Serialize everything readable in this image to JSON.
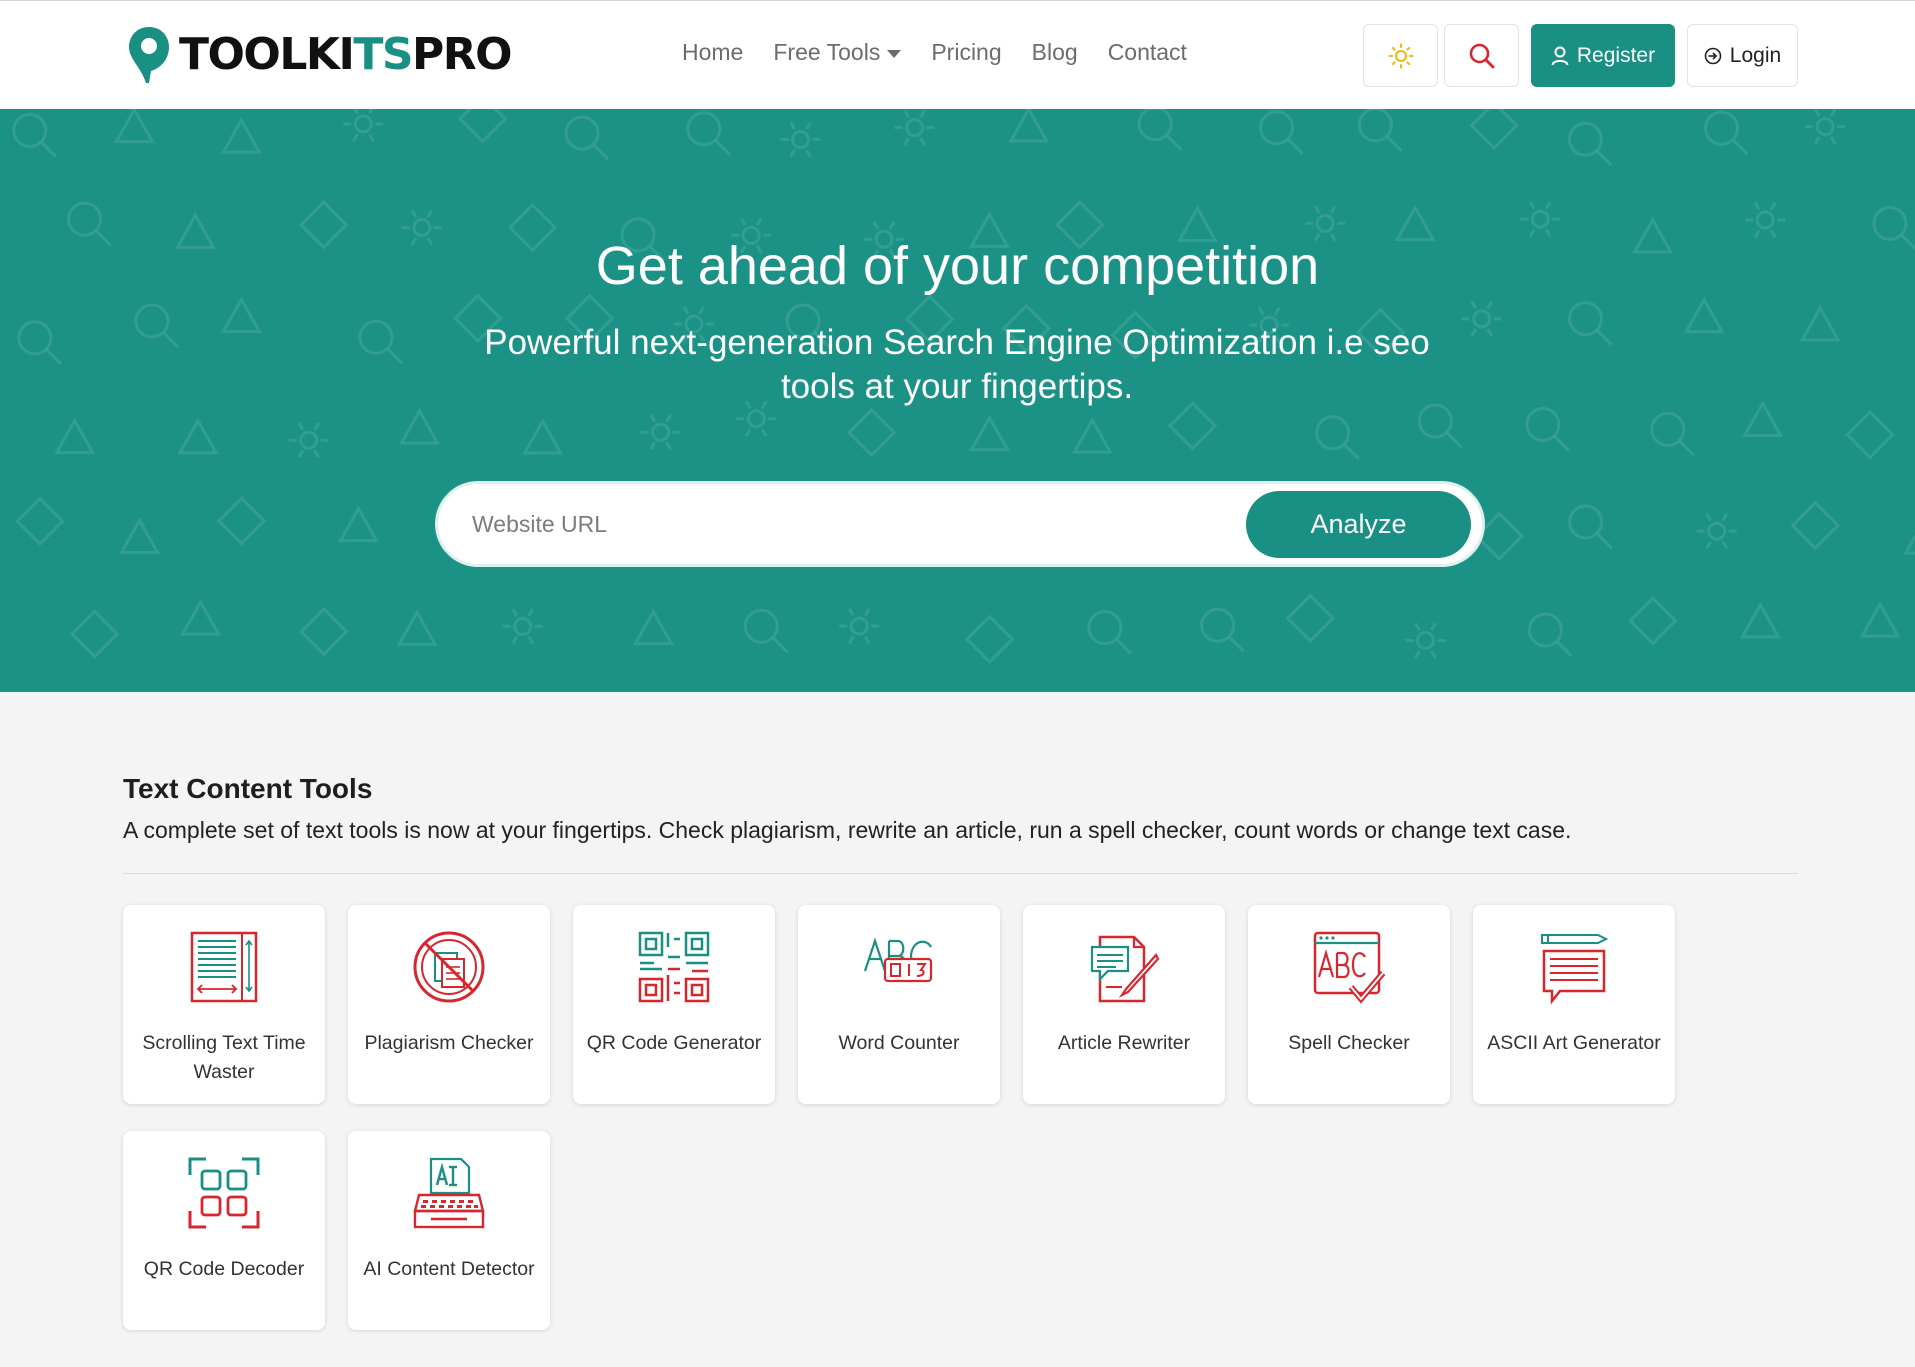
{
  "brand": {
    "part1": "TOOLKI",
    "part2": "TS",
    "part3": "PRO",
    "pin_color": "#1a8f83"
  },
  "nav": {
    "links": [
      "Home",
      "Free Tools",
      "Pricing",
      "Blog",
      "Contact"
    ],
    "theme_icon": "sun-icon",
    "search_icon": "search-icon",
    "register_label": "Register",
    "login_label": "Login"
  },
  "hero": {
    "title": "Get ahead of your competition",
    "subtitle": "Powerful next-generation Search Engine Optimization i.e seo tools at your fingertips.",
    "input_placeholder": "Website URL",
    "button_label": "Analyze",
    "background_color": "#1c9286"
  },
  "section": {
    "title": "Text Content Tools",
    "description": "A complete set of text tools is now at your fingertips. Check plagiarism, rewrite an article, run a spell checker, count words or change text case.",
    "tools": [
      {
        "label": "Scrolling Text Time Waster",
        "icon": "scrolling-text-icon"
      },
      {
        "label": "Plagiarism Checker",
        "icon": "plagiarism-icon"
      },
      {
        "label": "QR Code Generator",
        "icon": "qr-code-icon"
      },
      {
        "label": "Word Counter",
        "icon": "word-counter-icon"
      },
      {
        "label": "Article Rewriter",
        "icon": "article-rewriter-icon"
      },
      {
        "label": "Spell Checker",
        "icon": "spell-checker-icon"
      },
      {
        "label": "ASCII Art Generator",
        "icon": "ascii-art-icon"
      },
      {
        "label": "QR Code Decoder",
        "icon": "qr-decoder-icon"
      },
      {
        "label": "AI Content Detector",
        "icon": "ai-detector-icon"
      }
    ]
  },
  "colors": {
    "accent": "#1a8f83",
    "icon_red": "#d8262e",
    "icon_teal": "#1a8f83"
  }
}
